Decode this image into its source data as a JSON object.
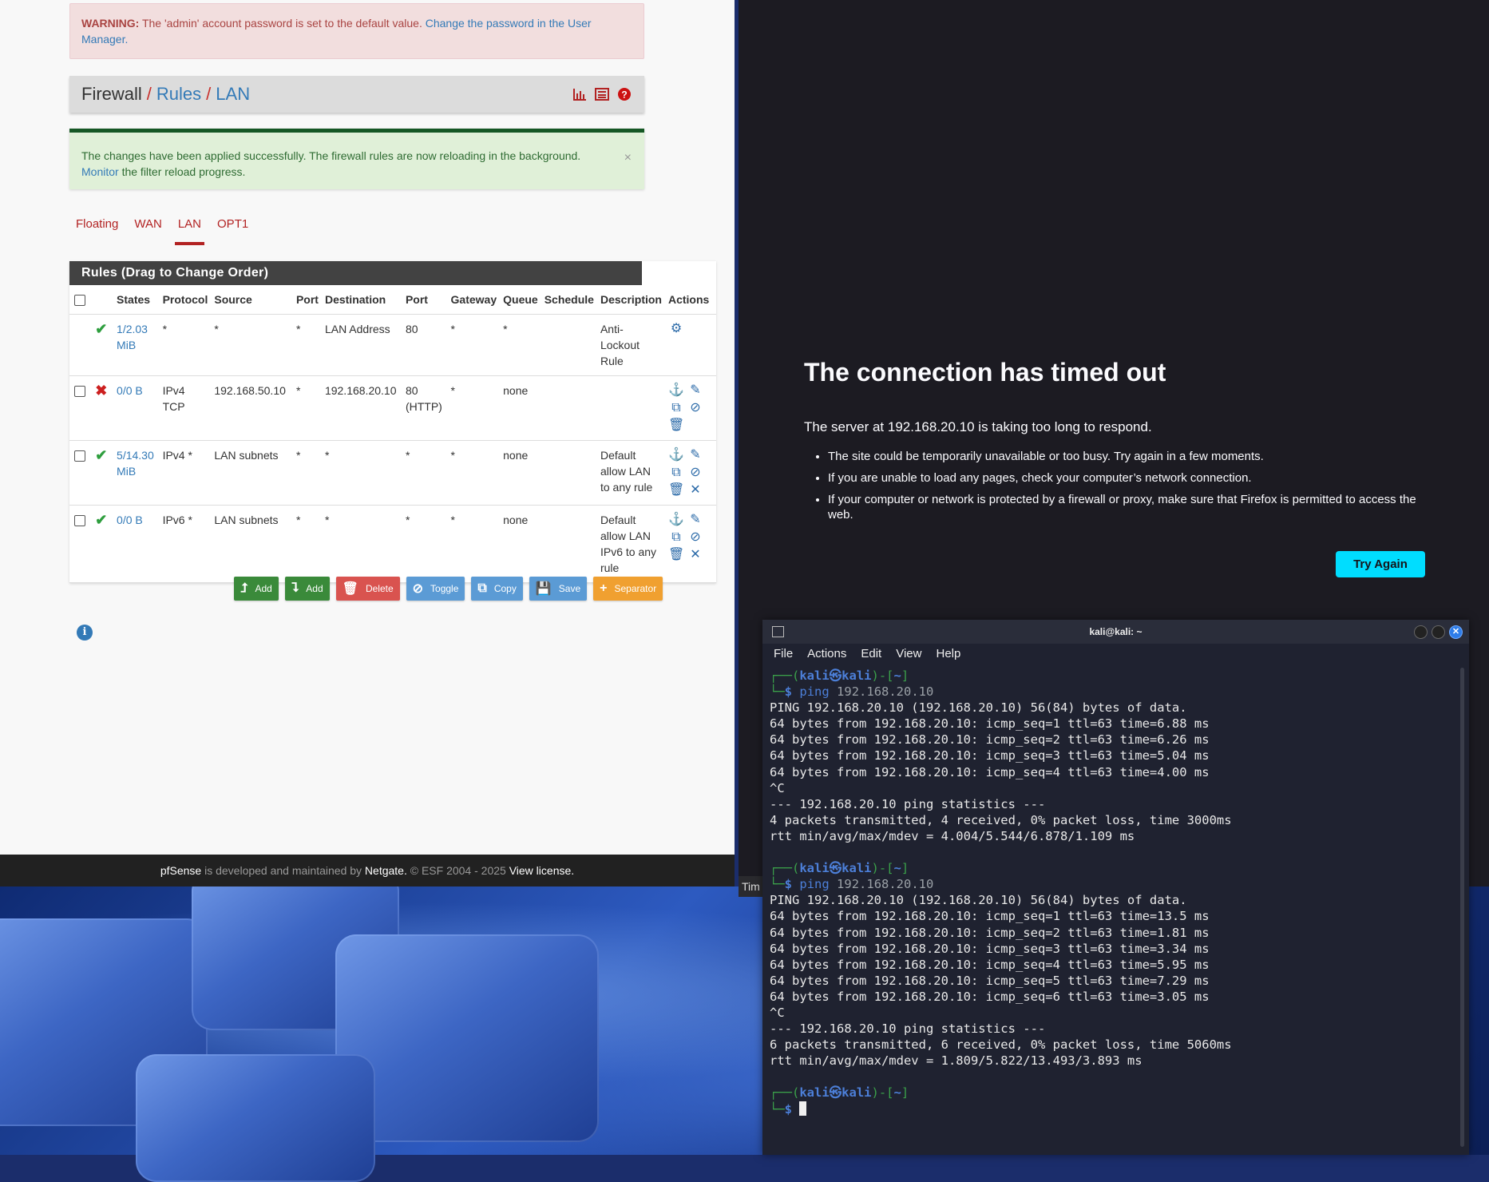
{
  "pfsense": {
    "warning": {
      "strong": "WARNING:",
      "text": "The 'admin' account password is set to the default value.",
      "link": "Change the password in the User Manager."
    },
    "breadcrumb": {
      "firewall": "Firewall",
      "rules": "Rules",
      "lan": "LAN",
      "sep": "/"
    },
    "success": {
      "text": "The changes have been applied successfully. The firewall rules are now reloading in the background.",
      "link": "Monitor",
      "tail": "the filter reload progress.",
      "close": "×"
    },
    "tabs": [
      {
        "label": "Floating"
      },
      {
        "label": "WAN"
      },
      {
        "label": "LAN"
      },
      {
        "label": "OPT1"
      }
    ],
    "table_title": "Rules (Drag to Change Order)",
    "columns": [
      "States",
      "Protocol",
      "Source",
      "Port",
      "Destination",
      "Port",
      "Gateway",
      "Queue",
      "Schedule",
      "Description",
      "Actions"
    ],
    "rows": [
      {
        "states": "1/2.03 MiB",
        "protocol": "*",
        "source": "*",
        "sport": "*",
        "dest": "LAN Address",
        "dport": "80",
        "gateway": "*",
        "queue": "*",
        "schedule": "",
        "desc": "Anti-Lockout Rule"
      },
      {
        "states": "0/0 B",
        "protocol": "IPv4 TCP",
        "source": "192.168.50.10",
        "sport": "*",
        "dest": "192.168.20.10",
        "dport": "80 (HTTP)",
        "gateway": "*",
        "queue": "none",
        "schedule": "",
        "desc": ""
      },
      {
        "states": "5/14.30 MiB",
        "protocol": "IPv4 *",
        "source": "LAN subnets",
        "sport": "*",
        "dest": "*",
        "dport": "*",
        "gateway": "*",
        "queue": "none",
        "schedule": "",
        "desc": "Default allow LAN to any rule"
      },
      {
        "states": "0/0 B",
        "protocol": "IPv6 *",
        "source": "LAN subnets",
        "sport": "*",
        "dest": "*",
        "dport": "*",
        "gateway": "*",
        "queue": "none",
        "schedule": "",
        "desc": "Default allow LAN IPv6 to any rule"
      }
    ],
    "buttons": {
      "add_top": "Add",
      "add_bottom": "Add",
      "delete": "Delete",
      "toggle": "Toggle",
      "copy": "Copy",
      "save": "Save",
      "separator": "Separator"
    },
    "footer": {
      "brand": "pfSense",
      "mid": "is developed and maintained by",
      "company": "Netgate.",
      "copy": "© ESF 2004 - 2025",
      "license": "View license."
    }
  },
  "firefox": {
    "title": "The connection has timed out",
    "message": "The server at 192.168.20.10 is taking too long to respond.",
    "bullets": [
      "The site could be temporarily unavailable or too busy. Try again in a few moments.",
      "If you are unable to load any pages, check your computer’s network connection.",
      "If your computer or network is protected by a firewall or proxy, make sure that Firefox is permitted to access the web."
    ],
    "try_again": "Try Again",
    "tab_fragment": "Tim"
  },
  "terminal": {
    "title": "kali@kali: ~",
    "menu": [
      "File",
      "Actions",
      "Edit",
      "View",
      "Help"
    ],
    "prompt_user": "kali㉿kali",
    "prompt_dir": "~",
    "cmd_name": "ping",
    "cmd_arg": "192.168.20.10",
    "block1": [
      "PING 192.168.20.10 (192.168.20.10) 56(84) bytes of data.",
      "64 bytes from 192.168.20.10: icmp_seq=1 ttl=63 time=6.88 ms",
      "64 bytes from 192.168.20.10: icmp_seq=2 ttl=63 time=6.26 ms",
      "64 bytes from 192.168.20.10: icmp_seq=3 ttl=63 time=5.04 ms",
      "64 bytes from 192.168.20.10: icmp_seq=4 ttl=63 time=4.00 ms",
      "^C",
      "--- 192.168.20.10 ping statistics ---",
      "4 packets transmitted, 4 received, 0% packet loss, time 3000ms",
      "rtt min/avg/max/mdev = 4.004/5.544/6.878/1.109 ms"
    ],
    "block2": [
      "PING 192.168.20.10 (192.168.20.10) 56(84) bytes of data.",
      "64 bytes from 192.168.20.10: icmp_seq=1 ttl=63 time=13.5 ms",
      "64 bytes from 192.168.20.10: icmp_seq=2 ttl=63 time=1.81 ms",
      "64 bytes from 192.168.20.10: icmp_seq=3 ttl=63 time=3.34 ms",
      "64 bytes from 192.168.20.10: icmp_seq=4 ttl=63 time=5.95 ms",
      "64 bytes from 192.168.20.10: icmp_seq=5 ttl=63 time=7.29 ms",
      "64 bytes from 192.168.20.10: icmp_seq=6 ttl=63 time=3.05 ms",
      "^C",
      "--- 192.168.20.10 ping statistics ---",
      "6 packets transmitted, 6 received, 0% packet loss, time 5060ms",
      "rtt min/avg/max/mdev = 1.809/5.822/13.493/3.893 ms"
    ]
  },
  "colors": {
    "accent_red": "#b22222",
    "link_blue": "#337ab7",
    "ok_green": "#2e9e3e",
    "ff_button": "#00ddff"
  }
}
